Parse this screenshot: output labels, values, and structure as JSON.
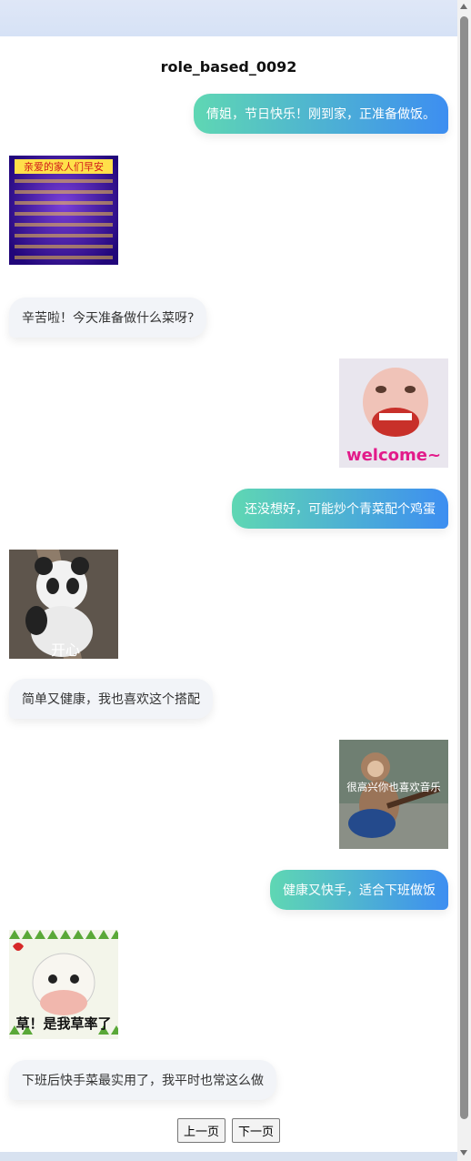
{
  "title": "role_based_0092",
  "messages": [
    {
      "role": "user",
      "text": "倩姐，节日快乐！刚到家，正准备做饭。"
    },
    {
      "role": "bot_sticker",
      "sticker": "family-greeting",
      "caption": "亲爱的家人们早安"
    },
    {
      "role": "bot",
      "text": "辛苦啦！今天准备做什么菜呀?"
    },
    {
      "role": "user_sticker",
      "sticker": "baby-welcome",
      "caption": "welcome~"
    },
    {
      "role": "user",
      "text": "还没想好，可能炒个青菜配个鸡蛋"
    },
    {
      "role": "bot_sticker",
      "sticker": "panda-happy",
      "caption": "开心"
    },
    {
      "role": "bot",
      "text": "简单又健康，我也喜欢这个搭配"
    },
    {
      "role": "user_sticker",
      "sticker": "monkey-guitar",
      "caption": "很高兴你也喜欢音乐"
    },
    {
      "role": "user",
      "text": "健康又快手，适合下班做饭"
    },
    {
      "role": "bot_sticker",
      "sticker": "cow-grass",
      "caption": "草！是我草率了"
    },
    {
      "role": "bot",
      "text": "下班后快手菜最实用了，我平时也常这么做"
    }
  ],
  "pager": {
    "prev_label": "上一页",
    "next_label": "下一页"
  },
  "colors": {
    "user_gradient_start": "#5fd7b3",
    "user_gradient_end": "#3d8ef1",
    "bot_bubble": "#f2f4f8"
  }
}
